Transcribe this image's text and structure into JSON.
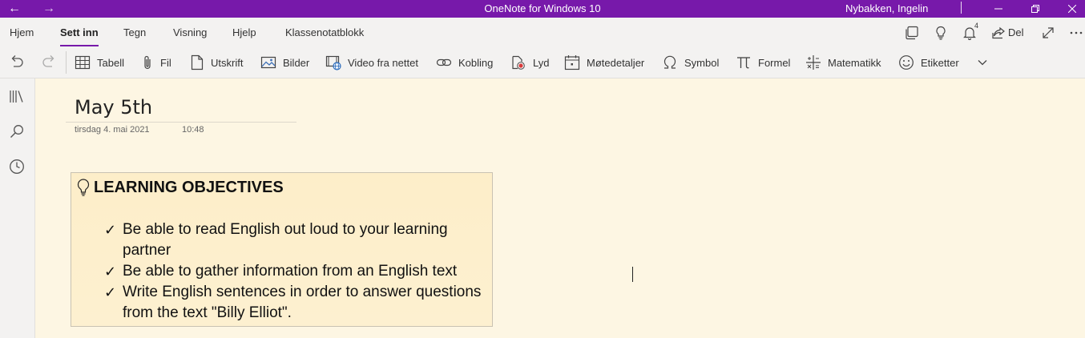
{
  "titlebar": {
    "back_glyph": "←",
    "forward_glyph": "→",
    "app_title": "OneNote for Windows 10",
    "user": "Nybakken, Ingelin"
  },
  "tabs": [
    {
      "label": "Hjem",
      "active": false
    },
    {
      "label": "Sett inn",
      "active": true
    },
    {
      "label": "Tegn",
      "active": false
    },
    {
      "label": "Visning",
      "active": false
    },
    {
      "label": "Hjelp",
      "active": false
    },
    {
      "label": "Klassenotatblokk",
      "active": false
    }
  ],
  "right_tools": {
    "notifications_count": "4",
    "share_label": "Del"
  },
  "ribbon": {
    "items": [
      {
        "label": "Tabell",
        "icon": "table-icon"
      },
      {
        "label": "Fil",
        "icon": "paperclip-icon"
      },
      {
        "label": "Utskrift",
        "icon": "printout-icon"
      },
      {
        "label": "Bilder",
        "icon": "picture-icon"
      },
      {
        "label": "Video fra nettet",
        "icon": "online-video-icon"
      },
      {
        "label": "Kobling",
        "icon": "link-icon"
      },
      {
        "label": "Lyd",
        "icon": "audio-icon"
      },
      {
        "label": "Møtedetaljer",
        "icon": "calendar-icon"
      },
      {
        "label": "Symbol",
        "icon": "omega-icon"
      },
      {
        "label": "Formel",
        "icon": "pi-icon"
      },
      {
        "label": "Matematikk",
        "icon": "math-icon"
      },
      {
        "label": "Etiketter",
        "icon": "smiley-icon"
      }
    ]
  },
  "page": {
    "title": "May 5th",
    "date": "tirsdag 4. mai 2021",
    "time": "10:48",
    "objectives": {
      "heading": "LEARNING OBJECTIVES",
      "check_glyph": "✓",
      "items": [
        "Be able to read English out loud to your learning partner",
        "Be able to gather information from an English text",
        "Write English sentences in order to answer questions from the text \"Billy Elliot\"."
      ]
    }
  },
  "colors": {
    "titlebar": "#7719aa",
    "ribbon_bg": "#f3f2f1",
    "page_bg": "#fdf6e3",
    "note_box_bg": "#fdeec9",
    "tab_underline": "#7719aa"
  }
}
